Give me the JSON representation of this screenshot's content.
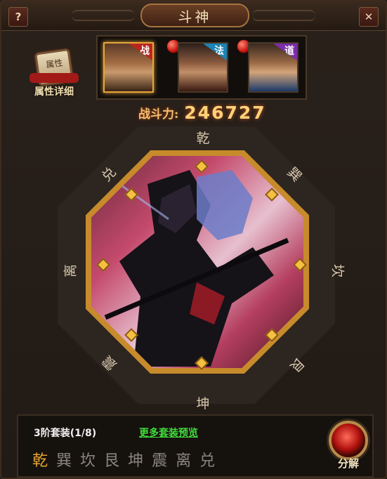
{
  "window": {
    "title": "斗神",
    "help_label": "?",
    "close_label": "✕"
  },
  "attribute_detail": {
    "label": "属性详细",
    "book_text": "属性"
  },
  "characters": [
    {
      "tag": "战",
      "selected": true
    },
    {
      "tag": "法",
      "selected": false
    },
    {
      "tag": "道",
      "selected": false
    }
  ],
  "combat_power": {
    "label": "战斗力:",
    "value": "246727"
  },
  "bagua": {
    "top": "乾",
    "top_right": "巽",
    "right": "坎",
    "bottom_right": "艮",
    "bottom": "坤",
    "bottom_left": "震",
    "left": "离",
    "top_left": "兑"
  },
  "set_info": {
    "title": "3阶套装(1/8)",
    "more_link": "更多套装预览"
  },
  "trigrams": [
    "乾",
    "巽",
    "坎",
    "艮",
    "坤",
    "震",
    "离",
    "兑"
  ],
  "decompose": {
    "label": "分解"
  },
  "colors": {
    "accent_gold": "#e3a232",
    "link_green": "#3fdc3a",
    "power_gold": "#ffd27a"
  }
}
